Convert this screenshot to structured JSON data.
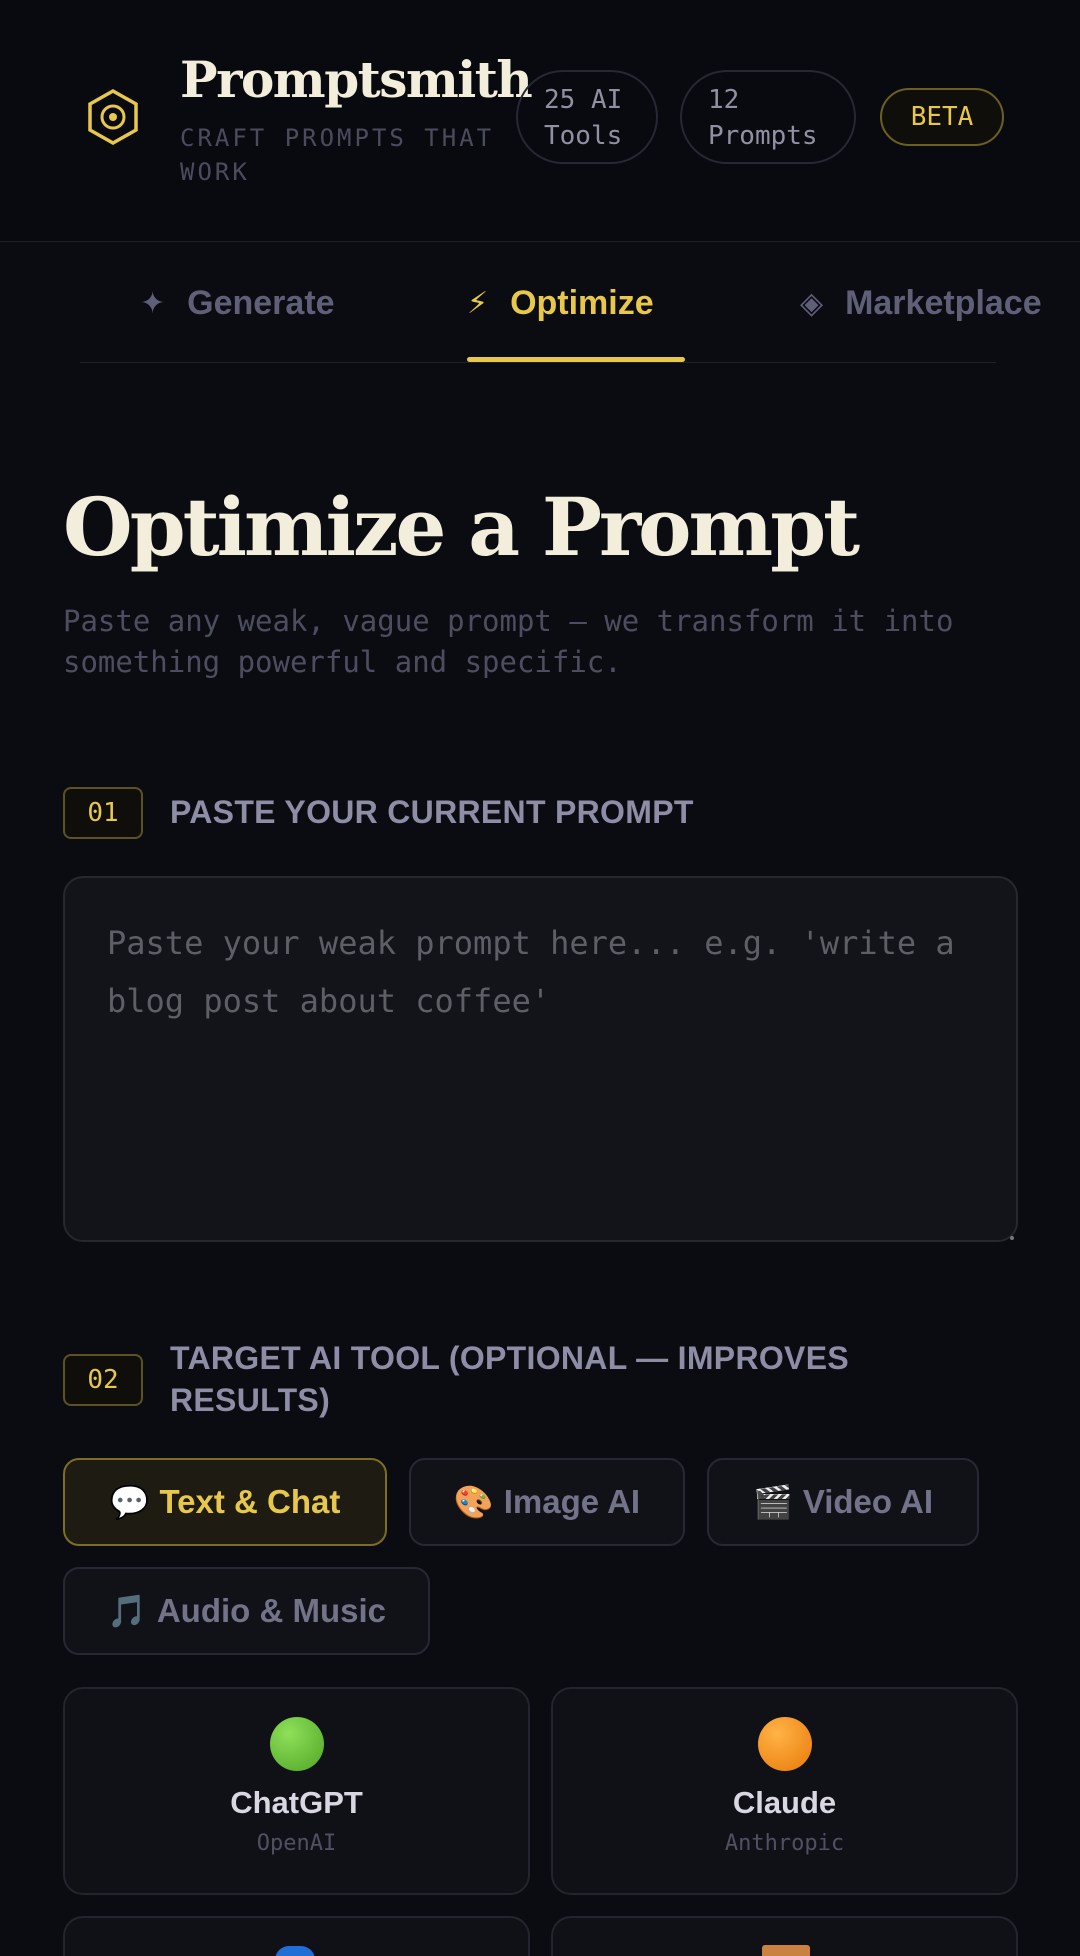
{
  "brand": {
    "name": "Promptsmith",
    "tagline": "CRAFT PROMPTS THAT WORK",
    "logo_icon": "hexagon-target-icon"
  },
  "header": {
    "tools_pill": "25 AI Tools",
    "prompts_pill": "12 Prompts",
    "badge": "BETA"
  },
  "tabs": [
    {
      "label": "Generate",
      "icon": "✦",
      "active": false
    },
    {
      "label": "Optimize",
      "icon": "⚡",
      "active": true
    },
    {
      "label": "Marketplace",
      "icon": "◈",
      "active": false
    }
  ],
  "page": {
    "title": "Optimize a Prompt",
    "subtitle": "Paste any weak, vague prompt — we transform it into something powerful and specific."
  },
  "step1": {
    "number": "01",
    "label": "PASTE YOUR CURRENT PROMPT",
    "placeholder": "Paste your weak prompt here... e.g. 'write a blog post about coffee'",
    "value": ""
  },
  "step2": {
    "number": "02",
    "label": "TARGET AI TOOL (OPTIONAL — IMPROVES RESULTS)",
    "categories": [
      {
        "emoji": "💬",
        "label": "Text & Chat",
        "selected": true
      },
      {
        "emoji": "🎨",
        "label": "Image AI",
        "selected": false
      },
      {
        "emoji": "🎬",
        "label": "Video AI",
        "selected": false
      },
      {
        "emoji": "🎵",
        "label": "Audio & Music",
        "selected": false
      }
    ],
    "tools": [
      {
        "name": "ChatGPT",
        "org": "OpenAI",
        "color": "#6cc23a"
      },
      {
        "name": "Claude",
        "org": "Anthropic",
        "color": "#f28a0f"
      }
    ]
  },
  "colors": {
    "accent": "#e8c84a",
    "background": "#0b0c12",
    "muted": "#5f6078"
  }
}
